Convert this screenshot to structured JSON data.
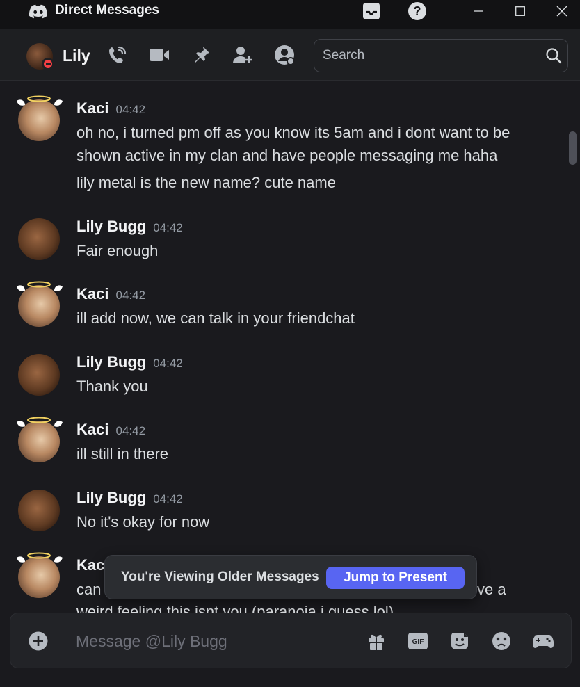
{
  "titlebar": {
    "title": "Direct Messages"
  },
  "header": {
    "user_name": "Lily",
    "search_placeholder": "Search"
  },
  "messages": [
    {
      "author": "Kaci",
      "time": "04:42",
      "avatar": "kaci",
      "lines": [
        "oh no, i turned pm off as you know its 5am and i dont want to be",
        "shown active in my clan and have people messaging me haha"
      ],
      "extra": "lily metal is the new name? cute name"
    },
    {
      "author": "Lily Bugg",
      "time": "04:42",
      "avatar": "lily",
      "lines": [
        "Fair enough"
      ]
    },
    {
      "author": "Kaci",
      "time": "04:42",
      "avatar": "kaci",
      "lines": [
        "ill add now, we can talk in your friendchat"
      ]
    },
    {
      "author": "Lily Bugg",
      "time": "04:42",
      "avatar": "lily",
      "lines": [
        "Thank you"
      ]
    },
    {
      "author": "Kaci",
      "time": "04:42",
      "avatar": "kaci",
      "lines": [
        "ill still in there"
      ]
    },
    {
      "author": "Lily Bugg",
      "time": "04:42",
      "avatar": "lily",
      "lines": [
        "No it's okay for now"
      ]
    },
    {
      "author": "Kac",
      "time": "",
      "avatar": "kaci",
      "lines": [
        "can",
        "weird feeling this isnt you (paranoia i guess lol)"
      ],
      "partial_right": "ve a"
    }
  ],
  "banner": {
    "text": "You're Viewing Older Messages",
    "button": "Jump to Present"
  },
  "composer": {
    "placeholder": "Message @Lily Bugg",
    "gif_label": "GIF"
  }
}
